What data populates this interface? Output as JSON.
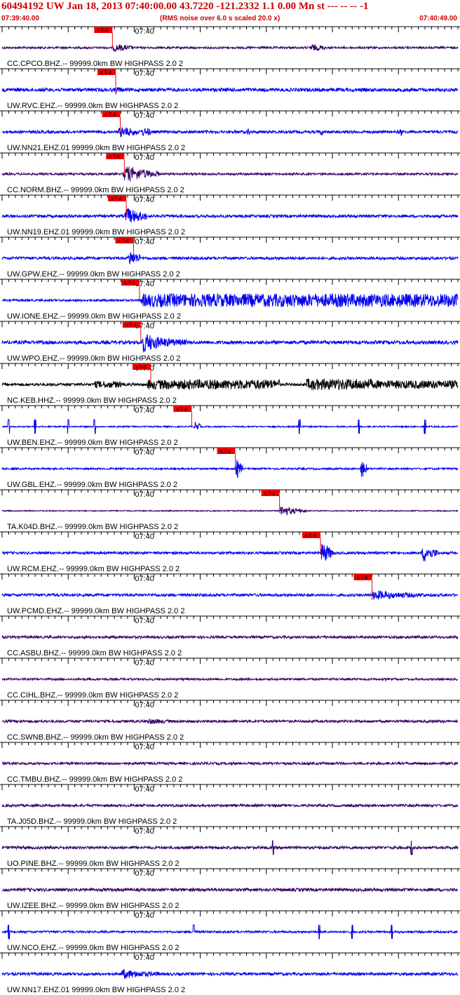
{
  "header": {
    "title": "60494192 UW Jan 18, 2013 07:40:00.00   43.7220 -121.2332  1.1 0.00 Mn st --- -- --  -1",
    "start_time": "07:39:40.00",
    "noise_note": "(RMS noise over 6.0 s scaled 20.0 x)",
    "end_time": "07:40:49.00"
  },
  "chart_data": {
    "type": "line",
    "x_unit": "seconds after 07:39:40.00",
    "xlim": [
      0,
      69
    ],
    "tick_interval_s": 1,
    "major_tick_interval_s": 10,
    "minute_label": "07:40",
    "minute_label_time_s": 20,
    "pick_marker_label": "x:T-4",
    "colors": {
      "blue": "#0000ee",
      "purple": "#330066",
      "black": "#000000",
      "pick": "#ee0000",
      "axis": "#000000"
    },
    "traces": [
      {
        "name": "CC.CPCO.BHZ.-- 99999.0km BW  HIGHPASS  2.0  2",
        "color": "purple",
        "pick_s": 16.7,
        "bursts": [
          [
            16.7,
            3.0,
            5,
            2.5
          ],
          [
            46.5,
            2.5,
            4,
            2.5
          ]
        ],
        "noise": 1.5
      },
      {
        "name": "UW.RVC.EHZ.-- 99999.0km BW  HIGHPASS  2.0  2",
        "color": "blue",
        "pick_s": 17.2,
        "bursts": [
          [
            17.0,
            1.2,
            3,
            1.0
          ]
        ],
        "noise": 2.5,
        "spike_down": 28
      },
      {
        "name": "UW.NN21.EHZ.01 99999.0km BW  HIGHPASS  2.0  2",
        "color": "blue",
        "pick_s": 17.9,
        "bursts": [
          [
            17.5,
            3.0,
            7,
            3.0
          ],
          [
            21,
            1.5,
            5,
            2.0
          ],
          [
            37,
            0.6,
            6,
            0.8
          ],
          [
            48,
            0.6,
            4,
            0.8
          ],
          [
            60,
            0.6,
            5,
            0.8
          ]
        ],
        "noise": 2.0
      },
      {
        "name": "CC.NORM.BHZ.-- 99999.0km BW  HIGHPASS  2.0  2",
        "color": "purple",
        "pick_s": 18.5,
        "bursts": [
          [
            18.3,
            5.5,
            12,
            3.5
          ]
        ],
        "noise": 1.5
      },
      {
        "name": "UW.NN19.EHZ.01 99999.0km BW  HIGHPASS  2.0  2",
        "color": "blue",
        "pick_s": 18.8,
        "bursts": [
          [
            18.5,
            3.5,
            12,
            2.5
          ]
        ],
        "noise": 2.0
      },
      {
        "name": "UW.GPW.EHZ.-- 99999.0km BW  HIGHPASS  2.0  2",
        "color": "blue",
        "pick_s": 19.9,
        "bursts": [
          [
            19.0,
            2.0,
            12,
            1.5
          ]
        ],
        "noise": 2.0
      },
      {
        "name": "UW.IONE.EHZ.-- 99999.0km BW  HIGHPASS  2.0  2",
        "color": "blue",
        "pick_s": 20.8,
        "bursts": [
          [
            21.0,
            48,
            8,
            1000
          ]
        ],
        "noise": 1.5
      },
      {
        "name": "UW.WPO.EHZ.-- 99999.0km BW  HIGHPASS  2.0  2",
        "color": "blue",
        "pick_s": 21.0,
        "bursts": [
          [
            21.0,
            7.0,
            14,
            3.0
          ]
        ],
        "noise": 2.5
      },
      {
        "name": "NC.KEB.HHZ.-- 99999.0km BW  HIGHPASS  2.0  2",
        "color": "black",
        "pick_s": 22.5,
        "bursts": [
          [
            14,
            4,
            3,
            1000
          ],
          [
            22,
            20,
            5,
            1000
          ],
          [
            46,
            10,
            6,
            1000
          ],
          [
            56,
            13,
            4,
            1000
          ]
        ],
        "noise": 2.0
      },
      {
        "name": "UW.BEN.EHZ.-- 99999.0km BW  HIGHPASS  2.0  2",
        "color": "blue",
        "pick_s": 28.7,
        "bursts": [
          [
            29,
            1.0,
            10,
            0.8
          ]
        ],
        "noise": 1.0,
        "spikes": [
          1,
          5,
          10,
          14,
          45,
          54,
          64
        ],
        "spike_down": 22
      },
      {
        "name": "UW.GBL.EHZ.-- 99999.0km BW  HIGHPASS  2.0  2",
        "color": "blue",
        "pick_s": 35.3,
        "bursts": [
          [
            35.3,
            1.2,
            20,
            0.7
          ],
          [
            54.2,
            1.0,
            20,
            0.7
          ]
        ],
        "noise": 1.3
      },
      {
        "name": "TA.K04D.BHZ.-- 99999.0km BW  HIGHPASS  2.0  2",
        "color": "purple",
        "pick_s": 42.0,
        "bursts": [
          [
            42,
            4.0,
            9,
            2.0
          ]
        ],
        "noise": 0.8,
        "spike_down": 24
      },
      {
        "name": "UW.RCM.EHZ.-- 99999.0km BW  HIGHPASS  2.0  2",
        "color": "blue",
        "pick_s": 48.2,
        "bursts": [
          [
            48.2,
            2.0,
            20,
            1.2
          ],
          [
            63.5,
            2.5,
            14,
            1.5
          ]
        ],
        "noise": 1.8
      },
      {
        "name": "UW.PCMD.EHZ.-- 99999.0km BW  HIGHPASS  2.0  2",
        "color": "blue",
        "pick_s": 56.0,
        "bursts": [
          [
            56,
            8,
            6,
            4.0
          ]
        ],
        "noise": 2.0,
        "spike_down": 28
      },
      {
        "name": "CC.ASBU.BHZ.-- 99999.0km BW  HIGHPASS  2.0  2",
        "color": "purple",
        "bursts": [],
        "noise": 1.8
      },
      {
        "name": "CC.CIHL.BHZ.-- 99999.0km BW  HIGHPASS  2.0  2",
        "color": "purple",
        "bursts": [],
        "noise": 1.5
      },
      {
        "name": "CC.SWNB.BHZ.-- 99999.0km BW  HIGHPASS  2.0  2",
        "color": "purple",
        "bursts": [
          [
            22,
            4,
            3,
            2.0
          ]
        ],
        "noise": 1.8
      },
      {
        "name": "CC.TMBU.BHZ.-- 99999.0km BW  HIGHPASS  2.0  2",
        "color": "purple",
        "bursts": [],
        "noise": 1.8
      },
      {
        "name": "TA.J05D.BHZ.-- 99999.0km BW  HIGHPASS  2.0  2",
        "color": "purple",
        "bursts": [],
        "noise": 1.8
      },
      {
        "name": "UO.PINE.BHZ.-- 99999.0km BW  HIGHPASS  2.0  2",
        "color": "purple",
        "bursts": [],
        "noise": 2.0,
        "spikes": [
          41,
          62
        ]
      },
      {
        "name": "UW.IZEE.BHZ.-- 99999.0km BW  HIGHPASS  2.0  2",
        "color": "purple",
        "bursts": [],
        "noise": 2.2
      },
      {
        "name": "UW.NCO.EHZ.-- 99999.0km BW  HIGHPASS  2.0  2",
        "color": "blue",
        "bursts": [],
        "noise": 1.5,
        "spikes": [
          1,
          29,
          48,
          53,
          59
        ]
      },
      {
        "name": "UW.NN17.EHZ.01 99999.0km BW  HIGHPASS  2.0  2",
        "color": "blue",
        "bursts": [
          [
            18,
            6,
            6,
            3.0
          ]
        ],
        "noise": 2.0
      }
    ]
  }
}
